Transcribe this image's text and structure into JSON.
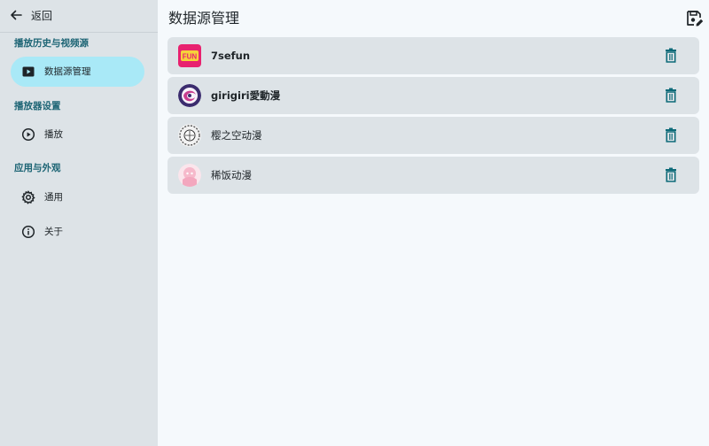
{
  "sidebar": {
    "back_label": "返回",
    "sections": [
      {
        "title": "播放历史与视频源",
        "items": [
          {
            "label": "数据源管理",
            "icon": "play-box-icon",
            "active": true
          }
        ]
      },
      {
        "title": "播放器设置",
        "items": [
          {
            "label": "播放",
            "icon": "play-circle-icon",
            "active": false
          }
        ]
      },
      {
        "title": "应用与外观",
        "items": [
          {
            "label": "通用",
            "icon": "gear-icon",
            "active": false
          },
          {
            "label": "关于",
            "icon": "info-icon",
            "active": false
          }
        ]
      }
    ]
  },
  "main": {
    "title": "数据源管理",
    "save_icon": "save-edit-icon",
    "sources": [
      {
        "name": "7sefun",
        "avatar_text": "FUN",
        "bold": true
      },
      {
        "name": "girigiri愛動漫",
        "avatar_text": "",
        "bold": false
      },
      {
        "name": "樱之空动漫",
        "avatar_text": "",
        "bold": false
      },
      {
        "name": "稀饭动漫",
        "avatar_text": "",
        "bold": false
      }
    ],
    "delete_icon": "trash-icon"
  },
  "colors": {
    "sidebar_bg": "#dde3e7",
    "active_pill": "#a9e9f7",
    "section_title": "#1c6474",
    "accent": "#0d6a78",
    "card_bg": "#dde3e7",
    "main_bg": "#f5f9fc"
  }
}
